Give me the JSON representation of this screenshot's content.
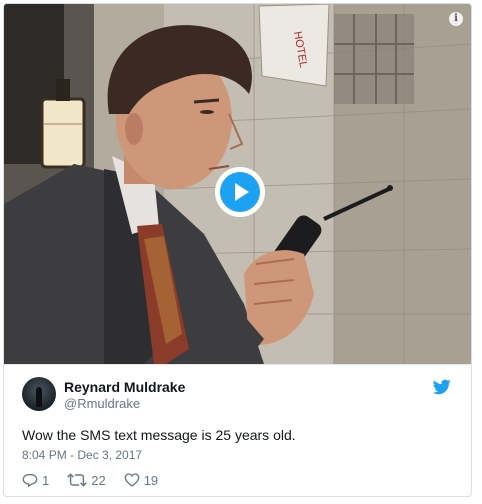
{
  "media": {
    "info_icon": "info-icon",
    "play_icon": "play-icon",
    "sign_text": "HOTEL"
  },
  "tweet": {
    "author_name": "Reynard Muldrake",
    "author_handle": "@Rmuldrake",
    "text": "Wow the SMS text message is 25 years old.",
    "timestamp": "8:04 PM - Dec 3, 2017",
    "brand_icon": "twitter-bird-icon",
    "brand_color": "#1da1f2"
  },
  "actions": {
    "reply_count": "1",
    "retweet_count": "22",
    "like_count": "19"
  },
  "colors": {
    "primary_text": "#14171a",
    "secondary_text": "#657786",
    "border": "#e1e8ed"
  }
}
